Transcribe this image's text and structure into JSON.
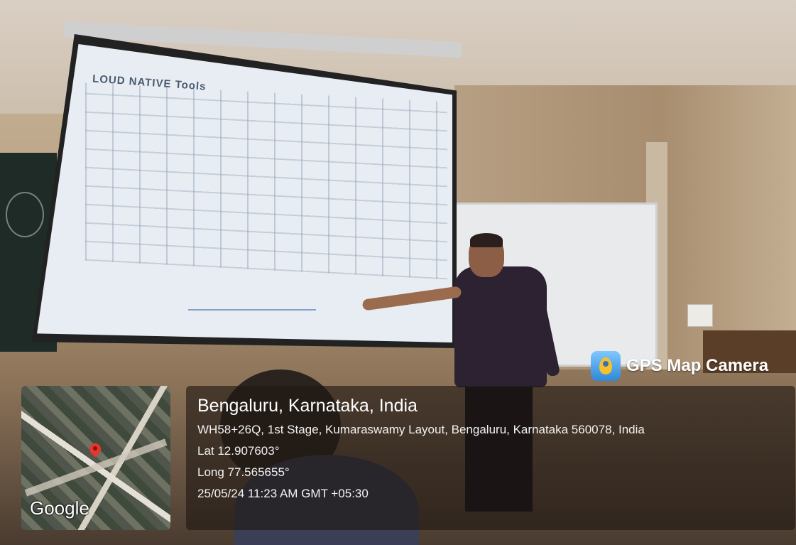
{
  "slide": {
    "title": "LOUD NATIVE Tools"
  },
  "watermark": {
    "app_name": "GPS Map Camera",
    "map_logo": "Google"
  },
  "location": {
    "city": "Bengaluru, Karnataka, India",
    "address": "WH58+26Q, 1st Stage, Kumaraswamy Layout, Bengaluru, Karnataka 560078, India",
    "latitude": "Lat 12.907603°",
    "longitude": "Long 77.565655°",
    "datetime": "25/05/24 11:23 AM GMT +05:30"
  },
  "icons": [
    "location-pin-icon",
    "gps-app-icon"
  ],
  "colors": {
    "overlay": "#1e1612",
    "pin": "#e8352d",
    "app_icon": "#2f88d8"
  }
}
